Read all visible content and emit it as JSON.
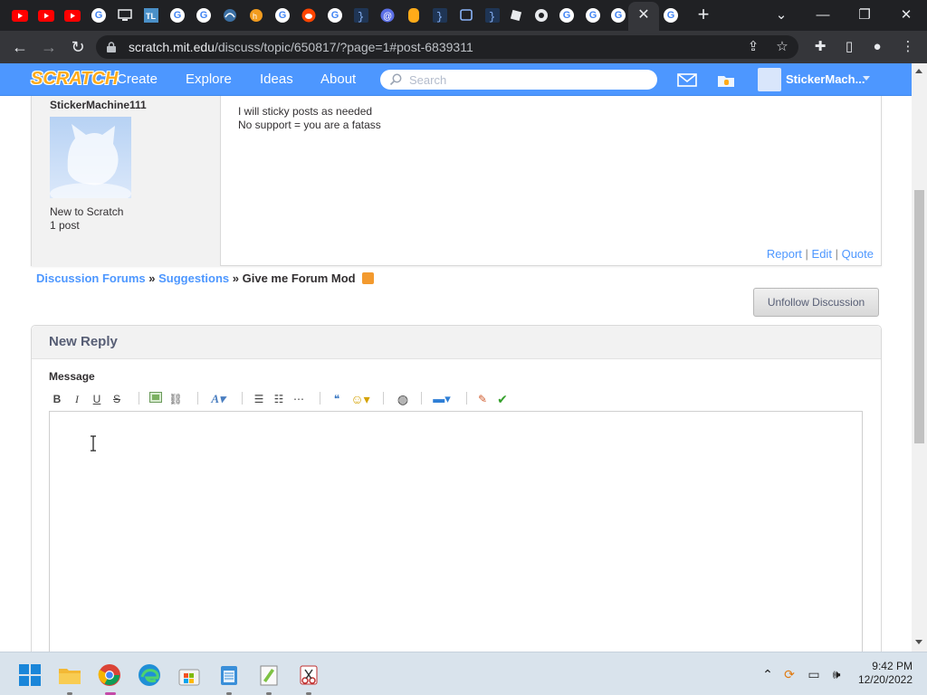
{
  "browser": {
    "url_host": "scratch.mit.edu",
    "url_path": "/discuss/topic/650817/?page=1#post-6839311"
  },
  "scratch_nav": {
    "logo": "SCRATCH",
    "links": [
      "Create",
      "Explore",
      "Ideas",
      "About"
    ],
    "search_placeholder": "Search",
    "username": "StickerMach..."
  },
  "post": {
    "author": "StickerMachine111",
    "status": "New to Scratch",
    "post_count": "1 post",
    "lines": [
      "I will sticky posts as needed",
      "No support = you are a fatass"
    ],
    "actions": [
      "Report",
      "Edit",
      "Quote"
    ],
    "separator": "|"
  },
  "breadcrumb": {
    "items": [
      "Discussion Forums",
      "Suggestions"
    ],
    "current": "Give me Forum Mod",
    "sep": "»"
  },
  "unfollow_label": "Unfollow Discussion",
  "reply": {
    "title": "New Reply",
    "message_label": "Message",
    "message_value": ""
  },
  "taskbar": {
    "time": "9:42 PM",
    "date": "12/20/2022"
  },
  "colors": {
    "scratch_blue": "#4d97ff",
    "chrome_dark": "#202124",
    "taskbar": "#d9e3ec"
  }
}
